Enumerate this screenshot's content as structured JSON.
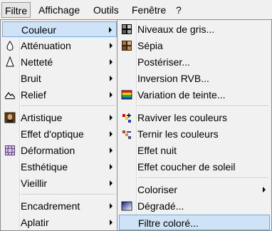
{
  "menubar": {
    "items": [
      "Filtre",
      "Affichage",
      "Outils",
      "Fenêtre",
      "?"
    ]
  },
  "filter_menu": {
    "items": [
      {
        "label": "Couleur",
        "icon": "none",
        "submenu": true
      },
      {
        "label": "Atténuation",
        "icon": "drop-icon",
        "submenu": true
      },
      {
        "label": "Netteté",
        "icon": "sharp-drop-icon",
        "submenu": true
      },
      {
        "label": "Bruit",
        "icon": "none",
        "submenu": true
      },
      {
        "label": "Relief",
        "icon": "relief-icon",
        "submenu": true
      },
      {
        "label": "Artistique",
        "icon": "portrait-icon",
        "submenu": true
      },
      {
        "label": "Effet d'optique",
        "icon": "none",
        "submenu": true
      },
      {
        "label": "Déformation",
        "icon": "grid-distort-icon",
        "submenu": true
      },
      {
        "label": "Esthétique",
        "icon": "none",
        "submenu": true
      },
      {
        "label": "Vieillir",
        "icon": "none",
        "submenu": true
      },
      {
        "label": "Encadrement",
        "icon": "none",
        "submenu": true
      },
      {
        "label": "Aplatir",
        "icon": "none",
        "submenu": true
      }
    ]
  },
  "color_submenu": {
    "items": [
      {
        "label": "Niveaux de gris...",
        "icon": "grayscale-icon"
      },
      {
        "label": "Sépia",
        "icon": "sepia-icon"
      },
      {
        "label": "Postériser...",
        "icon": "none"
      },
      {
        "label": "Inversion RVB...",
        "icon": "none"
      },
      {
        "label": "Variation de teinte...",
        "icon": "hue-icon"
      },
      {
        "label": "Raviver les couleurs",
        "icon": "vivid-icon"
      },
      {
        "label": "Ternir les couleurs",
        "icon": "dull-icon"
      },
      {
        "label": "Effet nuit",
        "icon": "none"
      },
      {
        "label": "Effet coucher de soleil",
        "icon": "none"
      },
      {
        "label": "Coloriser",
        "icon": "none",
        "submenu": true
      },
      {
        "label": "Dégradé...",
        "icon": "gradient-icon"
      },
      {
        "label": "Filtre coloré...",
        "icon": "none"
      }
    ]
  },
  "colors": {
    "highlight_bg": "#cfe3f7",
    "highlight_border": "#7aa7d7",
    "menu_bg": "#f1f1f1"
  }
}
